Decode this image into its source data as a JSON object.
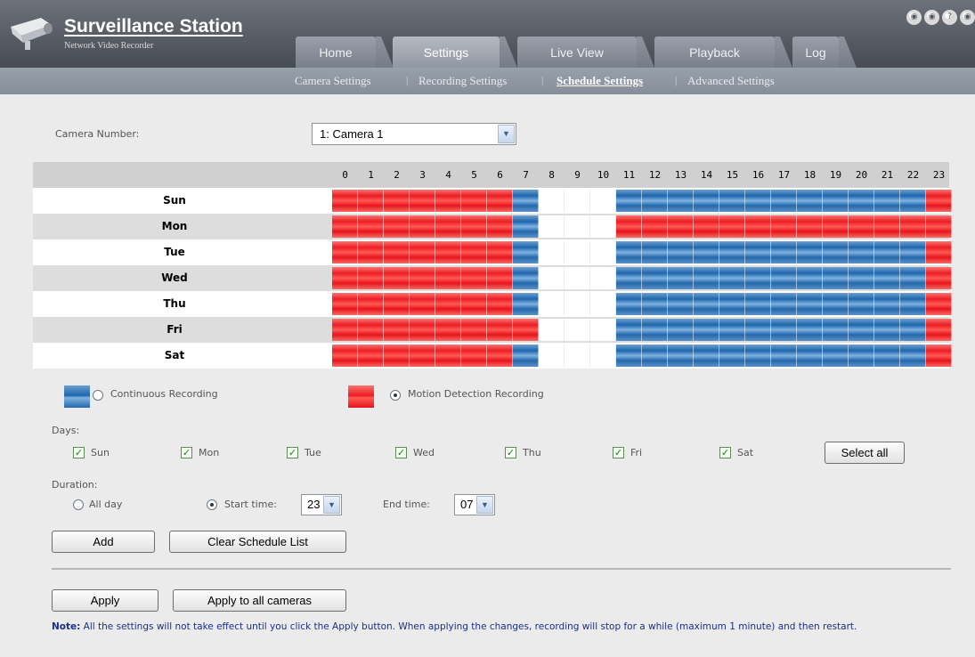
{
  "app": {
    "title": "Surveillance Station",
    "subtitle": "Network Video Recorder"
  },
  "tabs": [
    {
      "label": "Home",
      "active": false
    },
    {
      "label": "Settings",
      "active": true
    },
    {
      "label": "Live View",
      "active": false
    },
    {
      "label": "Playback",
      "active": false
    },
    {
      "label": "Log",
      "active": false
    }
  ],
  "subnav": [
    {
      "label": "Camera Settings",
      "active": false
    },
    {
      "label": "Recording Settings",
      "active": false
    },
    {
      "label": "Schedule Settings",
      "active": true
    },
    {
      "label": "Advanced Settings",
      "active": false
    }
  ],
  "camera": {
    "label": "Camera Number:",
    "selected": "1: Camera 1"
  },
  "schedule": {
    "hours": [
      "0",
      "1",
      "2",
      "3",
      "4",
      "5",
      "6",
      "7",
      "8",
      "9",
      "10",
      "11",
      "12",
      "13",
      "14",
      "15",
      "16",
      "17",
      "18",
      "19",
      "20",
      "21",
      "22",
      "23"
    ],
    "legend_key": {
      "M": "Motion Detection Recording",
      "C": "Continuous Recording",
      "N": "None"
    },
    "days": [
      {
        "label": "Sun",
        "cells": "MMMMMMMCNNNCCCCCCCCCCCCM"
      },
      {
        "label": "Mon",
        "cells": "MMMMMMMCNNNMMMMMMMMMMMMM"
      },
      {
        "label": "Tue",
        "cells": "MMMMMMMCNNNCCCCCCCCCCCCM"
      },
      {
        "label": "Wed",
        "cells": "MMMMMMMCNNNCCCCCCCCCCCCM"
      },
      {
        "label": "Thu",
        "cells": "MMMMMMMCNNNCCCCCCCCCCCCM"
      },
      {
        "label": "Fri",
        "cells": "MMMMMMMMNNNCCCCCCCCCCCCM"
      },
      {
        "label": "Sat",
        "cells": "MMMMMMMCNNNCCCCCCCCCCCCM"
      }
    ]
  },
  "legend": {
    "continuous_label": "Continuous Recording",
    "continuous_selected": false,
    "motion_label": "Motion Detection Recording",
    "motion_selected": true,
    "continuous_color": "#1f66ad",
    "motion_color": "#ed1c24"
  },
  "days_section": {
    "label": "Days:",
    "items": [
      {
        "label": "Sun",
        "checked": true
      },
      {
        "label": "Mon",
        "checked": true
      },
      {
        "label": "Tue",
        "checked": true
      },
      {
        "label": "Wed",
        "checked": true
      },
      {
        "label": "Thu",
        "checked": true
      },
      {
        "label": "Fri",
        "checked": true
      },
      {
        "label": "Sat",
        "checked": true
      }
    ],
    "select_all": "Select all"
  },
  "duration": {
    "label": "Duration:",
    "all_day_label": "All day",
    "all_day_selected": false,
    "start_label": "Start time:",
    "start_selected": true,
    "start_value": "23",
    "end_label": "End time:",
    "end_value": "07"
  },
  "buttons": {
    "add": "Add",
    "clear": "Clear Schedule List",
    "apply": "Apply",
    "apply_all": "Apply to all cameras"
  },
  "note": {
    "prefix": "Note:",
    "text": " All the settings will not take effect until you click the Apply button. When applying the changes, recording will stop for a while (maximum 1 minute) and then restart."
  }
}
